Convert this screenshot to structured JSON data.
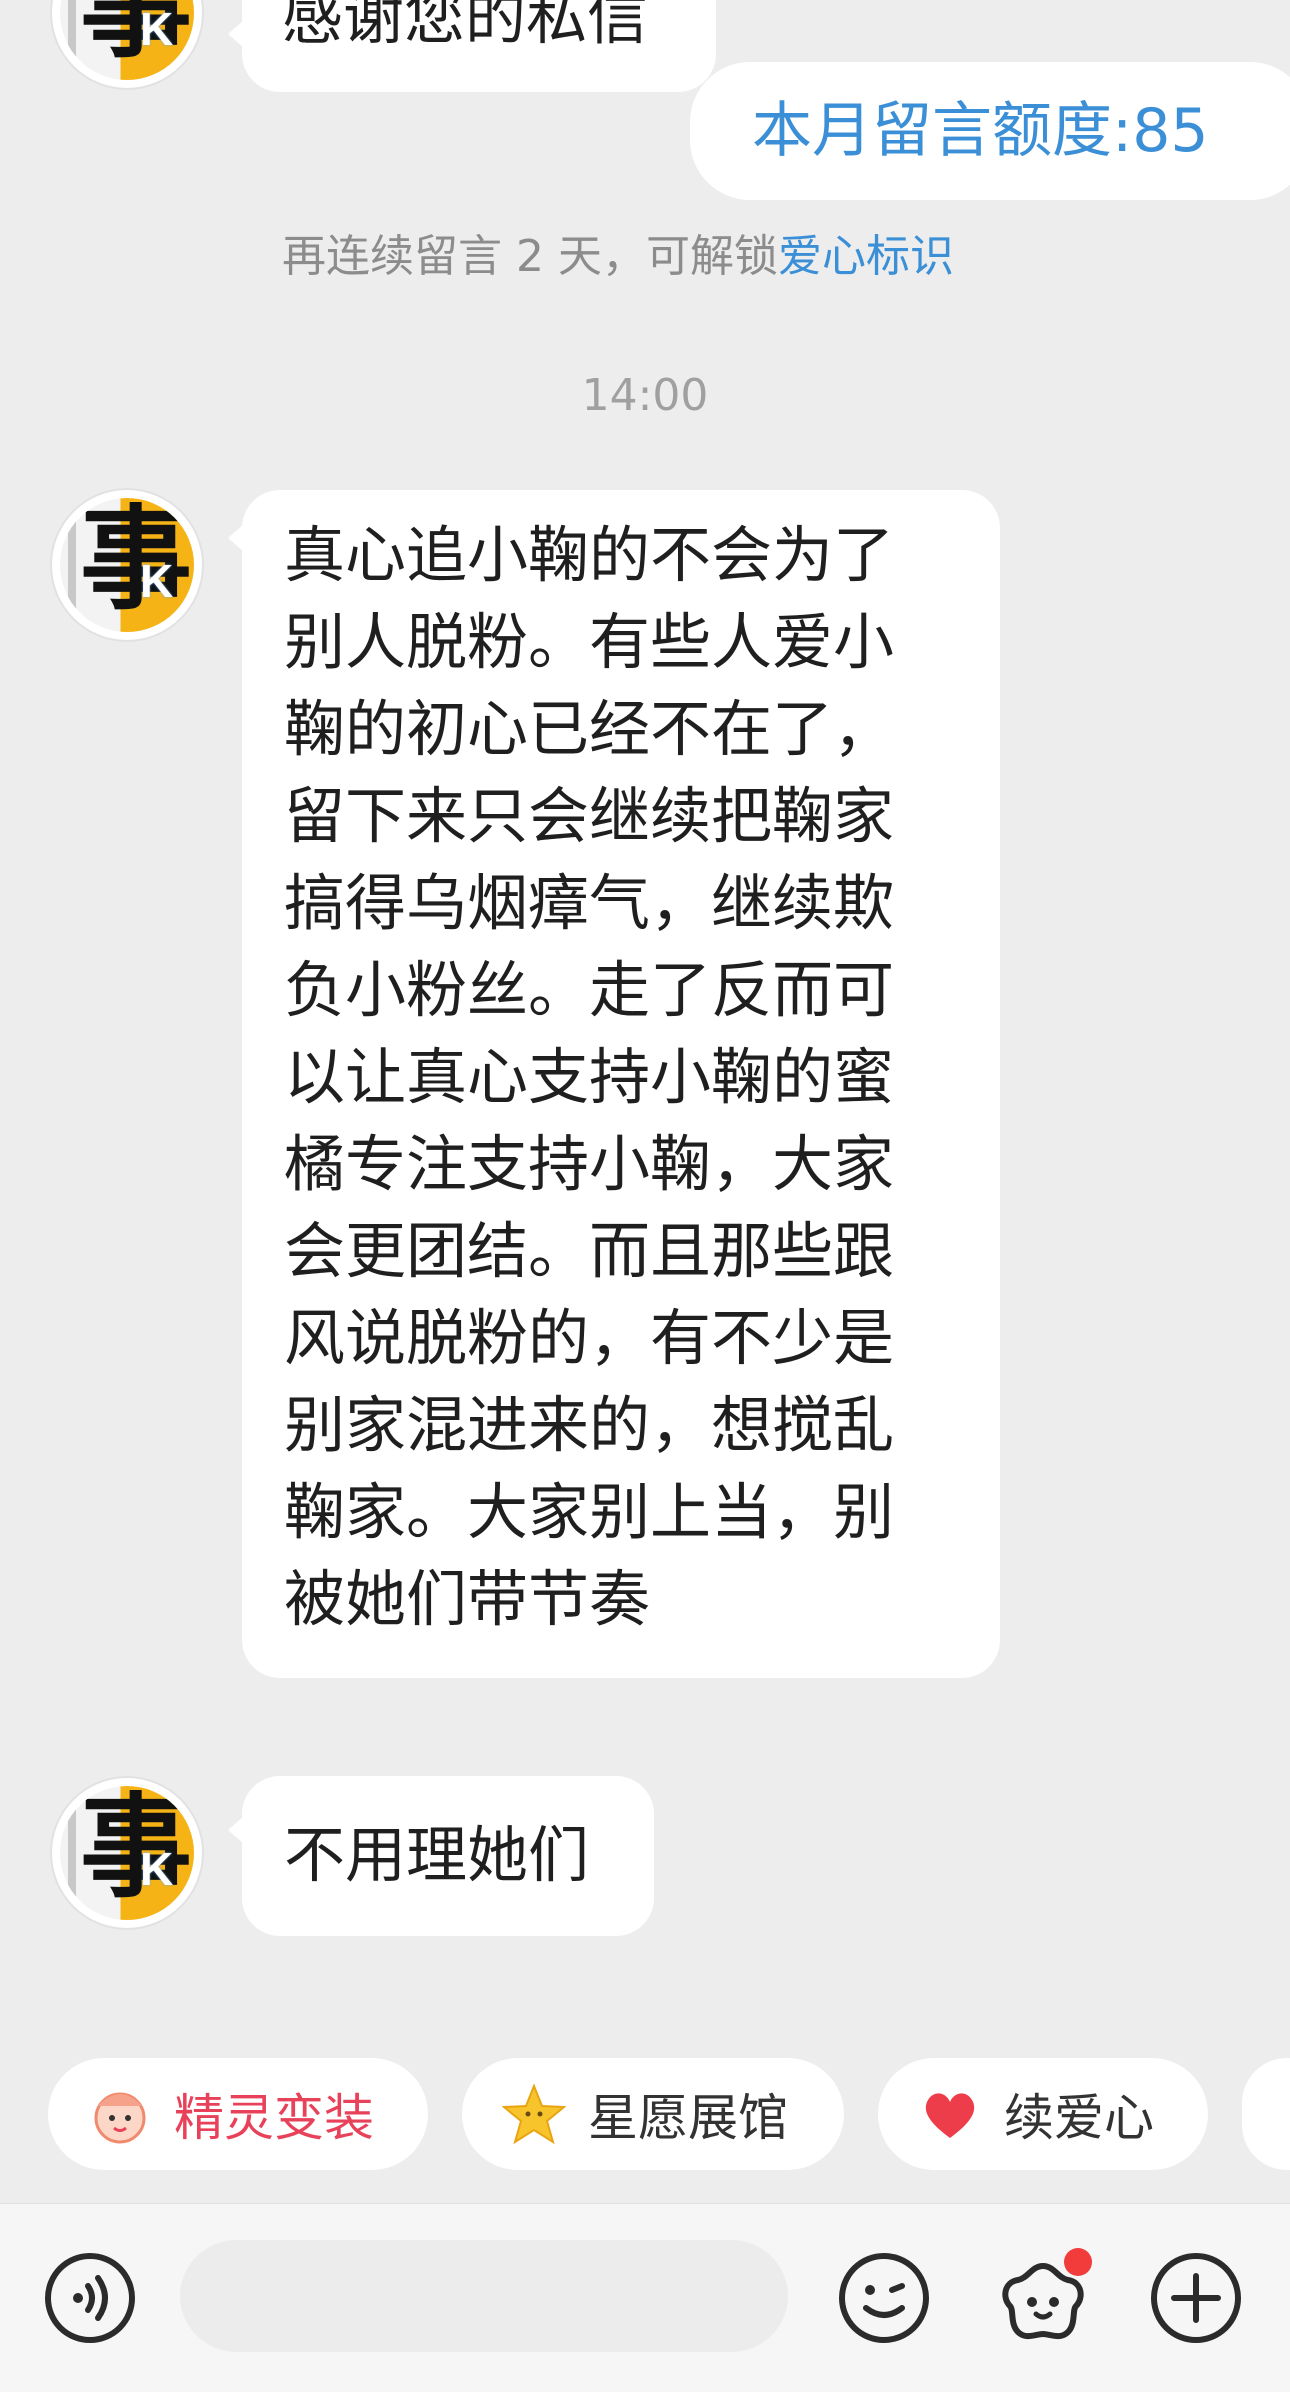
{
  "messages": {
    "top_partial": "感谢您的私信",
    "quota_label": "本月留言额度:85",
    "hint_text": "再连续留言 2 天，可解锁",
    "hint_link": "爱心标识",
    "timestamp": "14:00",
    "main_lines": [
      "真心追小鞠的不会为了",
      "别人脱粉。有些人爱小",
      "鞠的初心已经不在了，",
      "留下来只会继续把鞠家",
      "搞得乌烟瘴气，继续欺",
      "负小粉丝。走了反而可",
      "以让真心支持小鞠的蜜",
      "橘专注支持小鞠，大家",
      "会更团结。而且那些跟",
      "风说脱粉的，有不少是",
      "别家混进来的，想搅乱",
      "鞠家。大家别上当，别",
      "被她们带节奏"
    ],
    "last": "不用理她们"
  },
  "chips": [
    {
      "label": "精灵变装",
      "icon": "sprite-face-icon"
    },
    {
      "label": "星愿展馆",
      "icon": "star-icon"
    },
    {
      "label": "续爱心",
      "icon": "heart-icon"
    }
  ],
  "bottom_bar": {
    "voice_icon": "voice-icon",
    "emoji_icon": "emoji-icon",
    "sprite_icon": "sprite-icon",
    "add_icon": "add-icon"
  },
  "colors": {
    "accent": "#3b8fd6",
    "background": "#ededed",
    "notification_dot": "#f23b3b"
  }
}
